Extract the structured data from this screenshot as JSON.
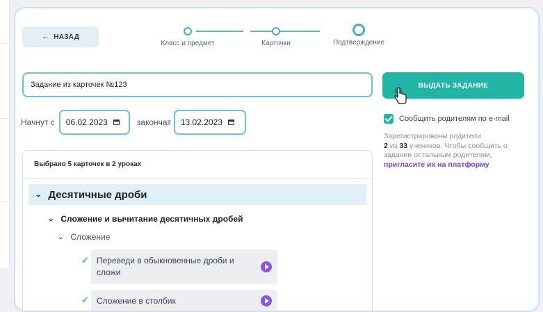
{
  "back_button": {
    "label": "НАЗАД",
    "icon": "arrow-left-icon"
  },
  "stepper": {
    "steps": [
      {
        "label": "Класс и предмет"
      },
      {
        "label": "Карточки"
      },
      {
        "label": "Подтверждение"
      }
    ],
    "current_step": "Подтверждение"
  },
  "task": {
    "name_value": "Задание из карточек №123"
  },
  "dates": {
    "start_label": "Начнут с",
    "start_value": "06.02.2023",
    "end_label": "закончат",
    "end_value": "13.02.2023"
  },
  "selection": {
    "summary": "Выбрано 5 карточек в 2 уроках",
    "topic": "Десятичные дроби",
    "lesson": "Сложение и вычитание десятичных дробей",
    "subtopic": "Сложение",
    "cards": [
      {
        "label": "Переведи в обыкновенные дроби и сложи"
      },
      {
        "label": "Сложение в столбик"
      }
    ]
  },
  "issue_button": {
    "label": "ВЫДАТЬ ЗАДАНИЕ"
  },
  "notify": {
    "label": "Сообщить родителям по e-mail",
    "checked": true
  },
  "parents_info": {
    "line1": "Зарегистрированы родители",
    "count": "2",
    "of_text": " из ",
    "total": "33",
    "line2_rest": " учеников. Чтобы сообщить о задании остальным родителям,",
    "invite_link": "пригласите их на платформу"
  },
  "colors": {
    "accent": "#22b4a5",
    "border_accent": "#6fc0dc",
    "link": "#7a3fdc",
    "play": "#8a55e3"
  }
}
